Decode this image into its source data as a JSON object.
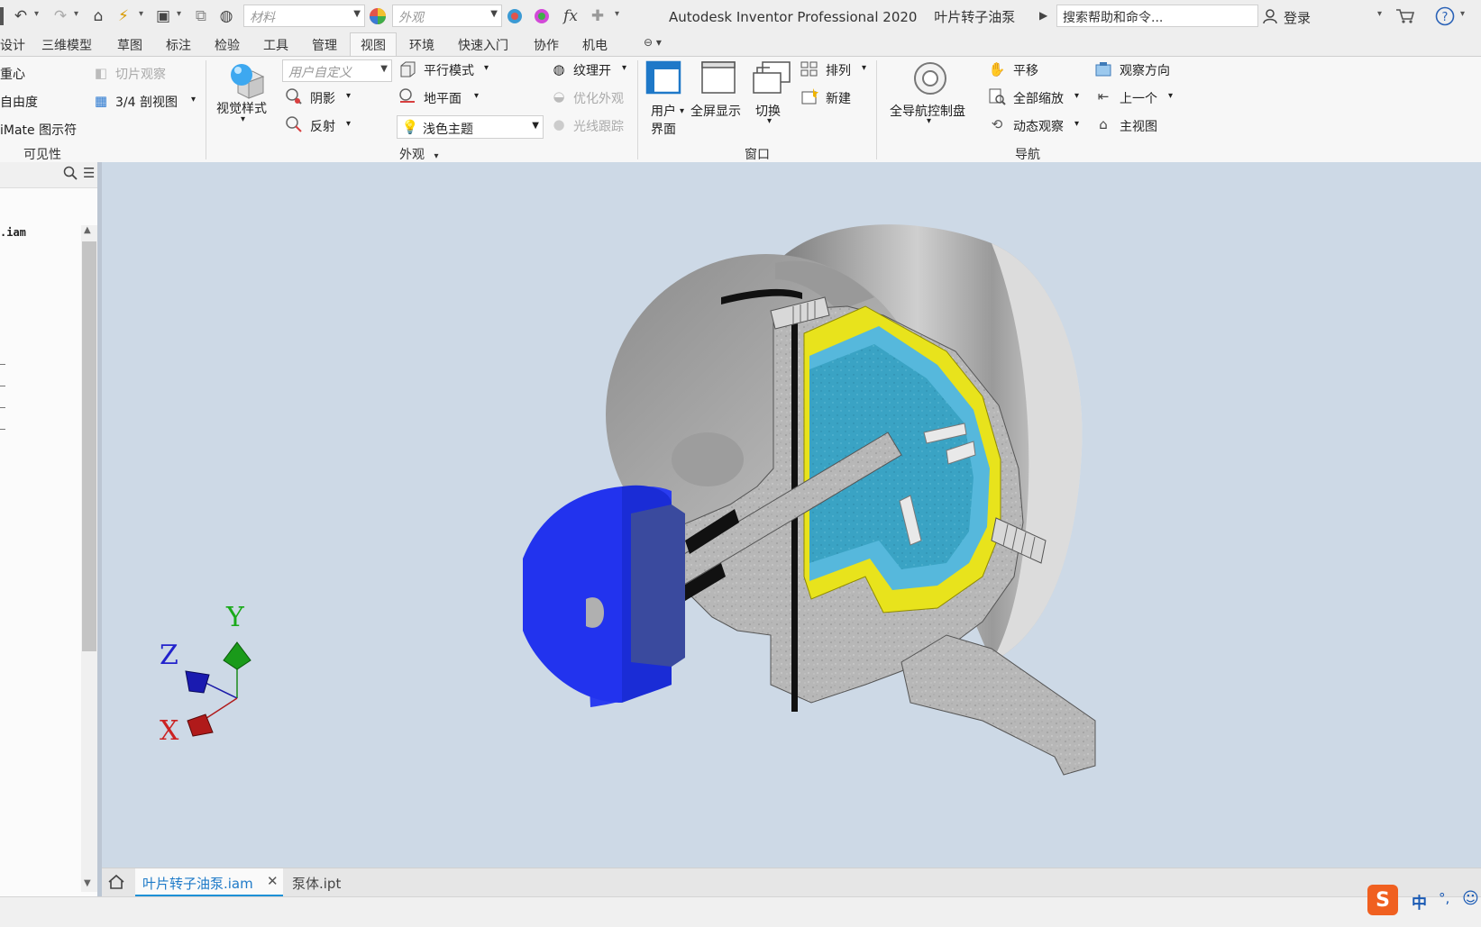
{
  "app_title": "Autodesk Inventor Professional 2020",
  "doc_name": "叶片转子油泵",
  "quick_access": {
    "material_placeholder": "材料",
    "appearance_placeholder": "外观",
    "search_placeholder": "搜索帮助和命令...",
    "login": "登录"
  },
  "tabs": [
    "设计",
    "三维模型",
    "草图",
    "标注",
    "检验",
    "工具",
    "管理",
    "视图",
    "环境",
    "快速入门",
    "协作",
    "机电"
  ],
  "active_tab": "视图",
  "ribbon": {
    "visibility": {
      "center_of_gravity": "重心",
      "dof": "自由度",
      "imate": "iMate 图示符",
      "slice": "切片观察",
      "section": "3/4 剖视图",
      "group": "可见性"
    },
    "appearance": {
      "visual_style": "视觉样式",
      "custom_combo": "用户自定义",
      "shadow": "阴影",
      "reflection": "反射",
      "parallel": "平行模式",
      "ground": "地平面",
      "light_theme": "浅色主题",
      "texture": "纹理开",
      "optimize": "优化外观",
      "raytrace": "光线跟踪",
      "group": "外观"
    },
    "window": {
      "user_interface_1": "用户",
      "user_interface_2": "界面",
      "fullscreen": "全屏显示",
      "switch": "切换",
      "arrange": "排列",
      "new": "新建",
      "group": "窗口"
    },
    "navigation": {
      "nav_wheel": "全导航控制盘",
      "pan": "平移",
      "zoom_all": "全部缩放",
      "orbit": "动态观察",
      "look_at": "观察方向",
      "previous": "上一个",
      "home": "主视图",
      "group": "导航"
    }
  },
  "browser": {
    "file": ".iam"
  },
  "axes": {
    "x": "X",
    "y": "Y",
    "z": "Z"
  },
  "doc_tabs": [
    {
      "label": "叶片转子油泵.iam",
      "active": true
    },
    {
      "label": "泵体.ipt",
      "active": false
    }
  ],
  "ime": {
    "lang": "中",
    "punct": "°,"
  },
  "colors": {
    "viewport_bg": "#cdd9e6",
    "accent_blue": "#1e90d6",
    "part_blue": "#2233ee",
    "cavity_cyan": "#3aa6c9",
    "gasket_yellow": "#e8e31c",
    "metal_gray": "#a8a8a8"
  }
}
